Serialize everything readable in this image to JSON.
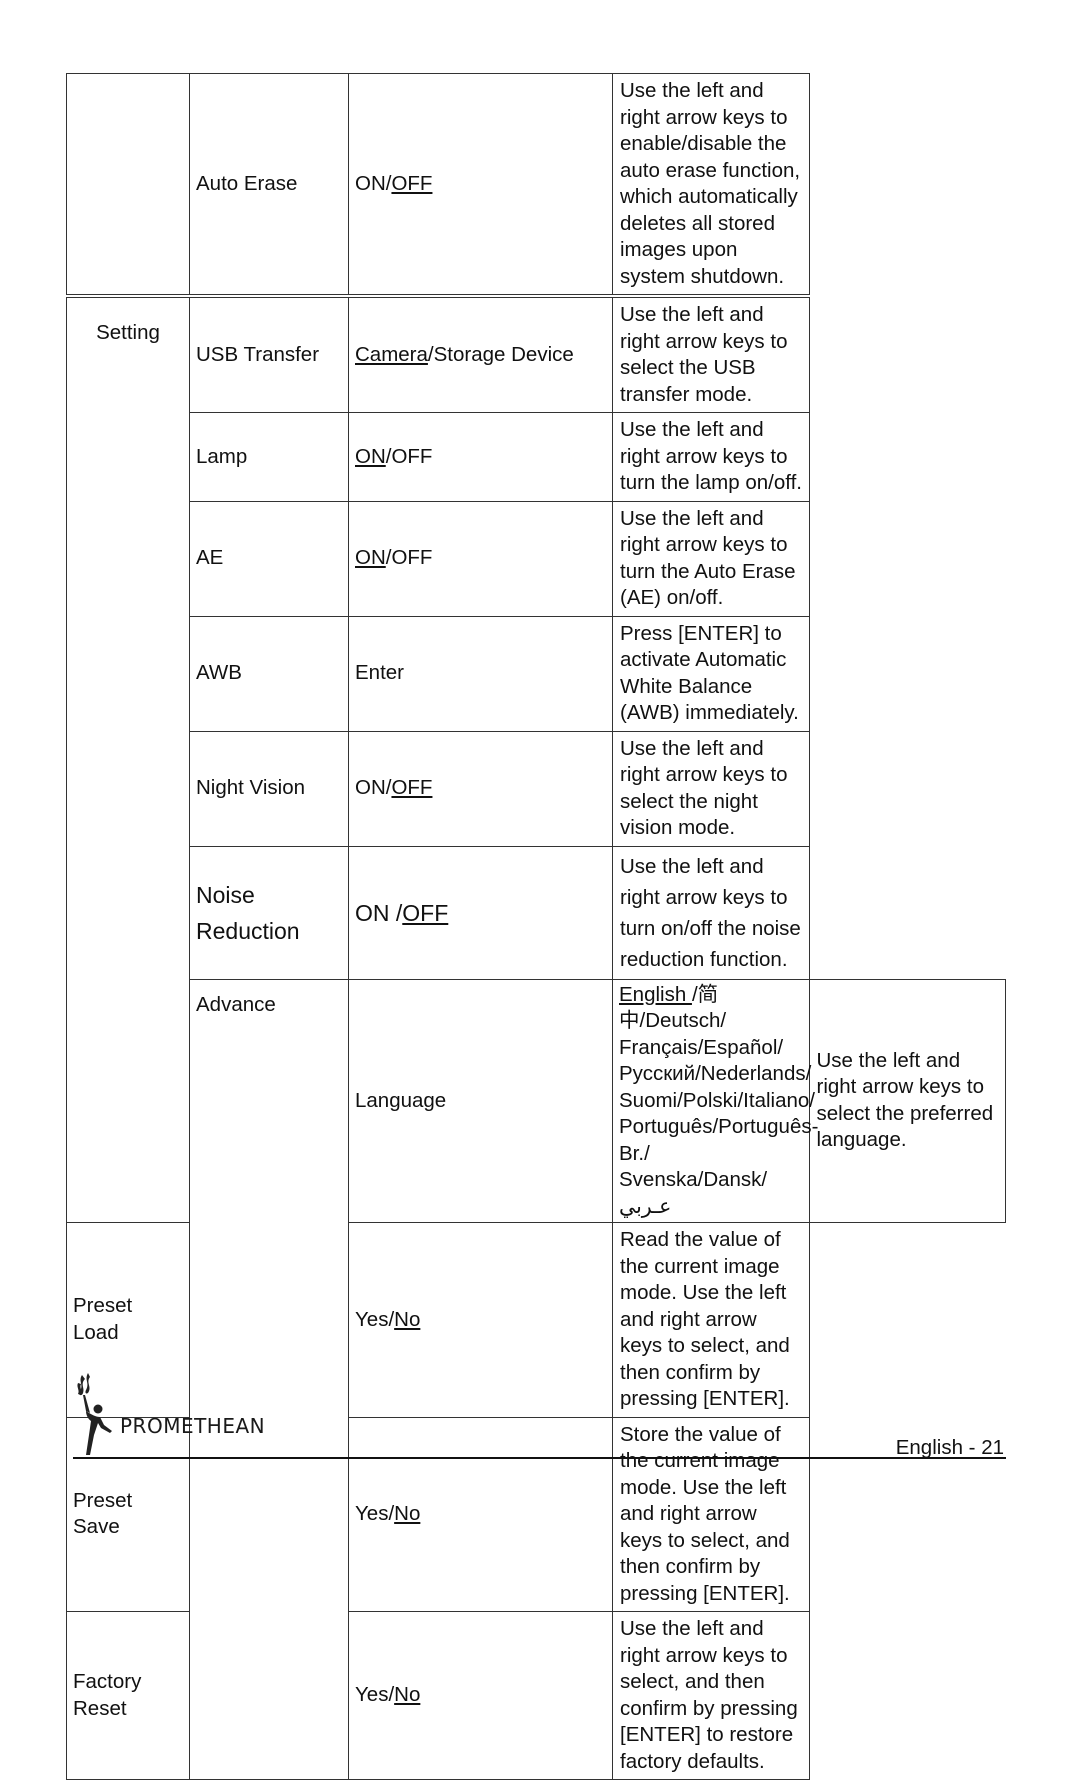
{
  "table": {
    "rows": [
      {
        "section": "",
        "item": "Auto Erase",
        "option_parts": [
          {
            "text": "ON/",
            "selected": false
          },
          {
            "text": "OFF",
            "selected": true
          }
        ],
        "description": "Use the left and right arrow keys to enable/disable the auto erase function, which automatically deletes all stored images upon system shutdown."
      },
      {
        "section": "Setting",
        "item": "USB Transfer",
        "option_parts": [
          {
            "text": "Camera",
            "selected": true
          },
          {
            "text": "/Storage Device",
            "selected": false
          }
        ],
        "description": "Use the left and right arrow keys to select the USB transfer mode."
      },
      {
        "section": "",
        "item": "Lamp",
        "option_parts": [
          {
            "text": "ON",
            "selected": true
          },
          {
            "text": "/OFF",
            "selected": false
          }
        ],
        "description": "Use the left and right arrow keys to turn the lamp on/off."
      },
      {
        "section": "",
        "item": "AE",
        "option_parts": [
          {
            "text": "ON",
            "selected": true
          },
          {
            "text": "/OFF",
            "selected": false
          }
        ],
        "description": "Use the left and right arrow keys to turn the Auto Erase (AE) on/off."
      },
      {
        "section": "",
        "item": "AWB",
        "option_parts": [
          {
            "text": "Enter",
            "selected": false
          }
        ],
        "description": "Press [ENTER] to activate Automatic White Balance (AWB) immediately."
      },
      {
        "section": "",
        "item": "Night Vision",
        "option_parts": [
          {
            "text": "ON/",
            "selected": false
          },
          {
            "text": "OFF",
            "selected": true
          }
        ],
        "description": "Use the left and right arrow keys to select the night vision mode."
      },
      {
        "section": "",
        "item_lines": [
          "Noise",
          "Reduction"
        ],
        "option_parts": [
          {
            "text": "ON /",
            "selected": false
          },
          {
            "text": "OFF",
            "selected": true
          }
        ],
        "description": "Use the left and right arrow keys to turn on/off the noise reduction function."
      },
      {
        "section": "Advance",
        "item": "Language",
        "option_lines": [
          [
            {
              "text": "English ",
              "selected": true
            },
            {
              "text": "/简中/Deutsch/",
              "selected": false
            }
          ],
          [
            {
              "text": "Français/Español/",
              "selected": false
            }
          ],
          [
            {
              "text": "Русский/Nederlands/",
              "selected": false
            }
          ],
          [
            {
              "text": "Suomi/Polski/Italiano/",
              "selected": false
            }
          ],
          [
            {
              "text": "Português/Português-Br./",
              "selected": false
            }
          ],
          [
            {
              "text": "Svenska/Dansk/عـربي",
              "selected": false
            }
          ]
        ],
        "description": "Use the left and right arrow keys to select the preferred language."
      },
      {
        "section": "",
        "item": "Preset Load",
        "option_parts": [
          {
            "text": "Yes/",
            "selected": false
          },
          {
            "text": "No",
            "selected": true
          }
        ],
        "description": "Read the value of the current image mode. Use the left and right arrow keys to select, and then confirm by pressing [ENTER]."
      },
      {
        "section": "",
        "item": "Preset Save",
        "option_parts": [
          {
            "text": "Yes/",
            "selected": false
          },
          {
            "text": "No",
            "selected": true
          }
        ],
        "description": "Store the value of the current image mode. Use the left and right arrow keys to select, and then confirm by pressing [ENTER]."
      },
      {
        "section": "",
        "item": "Factory Reset",
        "option_parts": [
          {
            "text": "Yes/",
            "selected": false
          },
          {
            "text": "No",
            "selected": true
          }
        ],
        "description": "Use the left and right arrow keys to select, and then confirm by pressing [ENTER] to restore factory defaults."
      }
    ]
  },
  "footer": {
    "brand": "PROMETHEAN",
    "logo_icon": "promethean-figure-icon",
    "page_label": "English - 21"
  }
}
